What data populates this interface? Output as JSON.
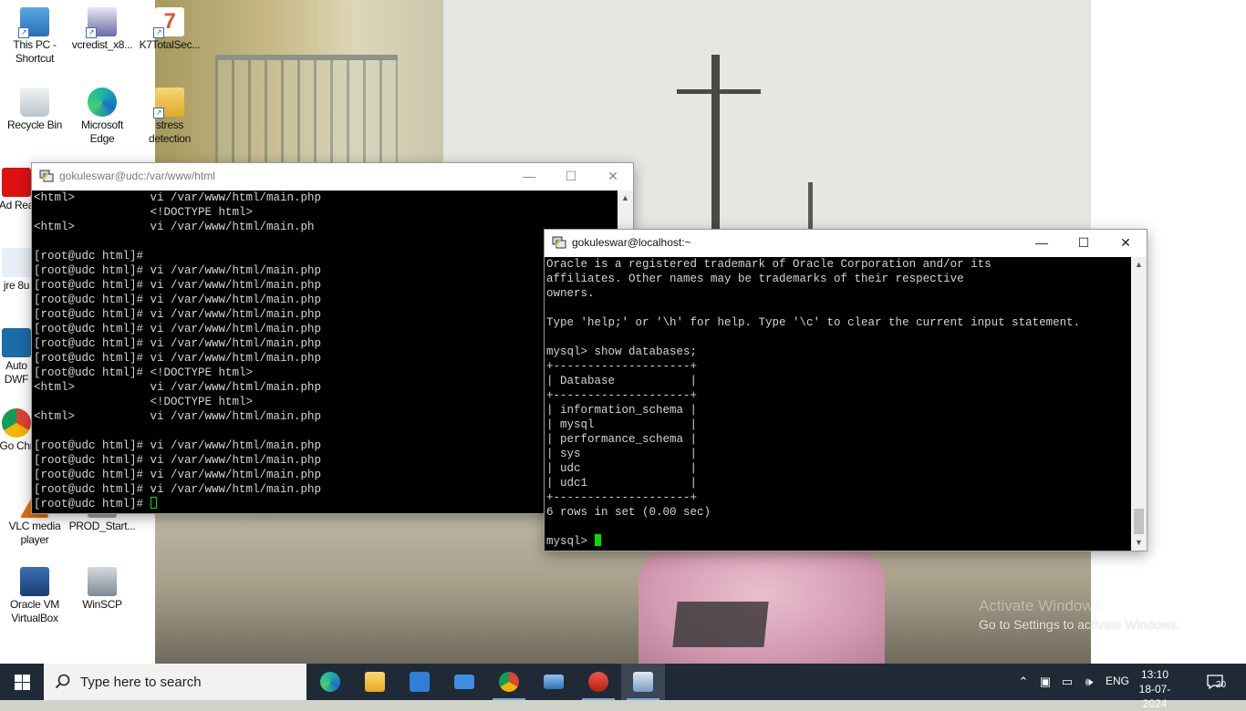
{
  "desktop": {
    "icons": [
      {
        "label": "This PC - Shortcut",
        "icon": "computer-icon"
      },
      {
        "label": "vcredist_x8...",
        "icon": "installer-icon"
      },
      {
        "label": "K7TotalSec...",
        "icon": "k7-antivirus-icon"
      },
      {
        "label": "Recycle Bin",
        "icon": "recycle-bin-icon"
      },
      {
        "label": "Microsoft Edge",
        "icon": "edge-icon"
      },
      {
        "label": "stress detection",
        "icon": "folder-icon"
      },
      {
        "label": "Ad Rea",
        "icon": "acrobat-icon"
      },
      {
        "label": "jre 8u",
        "icon": "java-icon"
      },
      {
        "label": "Auto DWF",
        "icon": "autodesk-icon"
      },
      {
        "label": "Go Chr",
        "icon": "chrome-icon"
      },
      {
        "label": "VLC media player",
        "icon": "vlc-icon"
      },
      {
        "label": "PROD_Start...",
        "icon": "file-icon"
      },
      {
        "label": "Oracle VM VirtualBox",
        "icon": "virtualbox-icon"
      },
      {
        "label": "WinSCP",
        "icon": "winscp-icon"
      }
    ],
    "watermark": {
      "title": "Activate Windows",
      "subtitle": "Go to Settings to activate Windows."
    }
  },
  "window_back": {
    "title": "gokuleswar@udc:/var/www/html",
    "lines": [
      "<html>           vi /var/www/html/main.php",
      "                 <!DOCTYPE html>",
      "<html>           vi /var/www/html/main.ph",
      "",
      "[root@udc html]#",
      "[root@udc html]# vi /var/www/html/main.php",
      "[root@udc html]# vi /var/www/html/main.php",
      "[root@udc html]# vi /var/www/html/main.php",
      "[root@udc html]# vi /var/www/html/main.php",
      "[root@udc html]# vi /var/www/html/main.php",
      "[root@udc html]# vi /var/www/html/main.php",
      "[root@udc html]# vi /var/www/html/main.php",
      "[root@udc html]# <!DOCTYPE html>",
      "<html>           vi /var/www/html/main.php",
      "                 <!DOCTYPE html>",
      "<html>           vi /var/www/html/main.php",
      "",
      "[root@udc html]# vi /var/www/html/main.php",
      "[root@udc html]# vi /var/www/html/main.php",
      "[root@udc html]# vi /var/www/html/main.php",
      "[root@udc html]# vi /var/www/html/main.php"
    ],
    "prompt": "[root@udc html]# "
  },
  "window_front": {
    "title": "gokuleswar@localhost:~",
    "lines": [
      "Oracle is a registered trademark of Oracle Corporation and/or its",
      "affiliates. Other names may be trademarks of their respective",
      "owners.",
      "",
      "Type 'help;' or '\\h' for help. Type '\\c' to clear the current input statement.",
      "",
      "mysql> show databases;",
      "+--------------------+",
      "| Database           |",
      "+--------------------+",
      "| information_schema |",
      "| mysql              |",
      "| performance_schema |",
      "| sys                |",
      "| udc                |",
      "| udc1               |",
      "+--------------------+",
      "6 rows in set (0.00 sec)",
      ""
    ],
    "prompt": "mysql> "
  },
  "window_controls": {
    "minimize": "—",
    "maximize": "☐",
    "close": "✕"
  },
  "taskbar": {
    "search_placeholder": "Type here to search",
    "apps": [
      "edge-icon",
      "file-explorer-icon",
      "store-icon",
      "mail-icon",
      "chrome-icon",
      "remote-desktop-icon",
      "oracle-sql-icon",
      "putty-icon"
    ],
    "language": "ENG",
    "time": "13:10",
    "date": "18-07-2024",
    "notifications": "20"
  },
  "colors": {
    "terminal_bg": "#000000",
    "terminal_fg": "#d4d4d4",
    "cursor": "#00e000",
    "taskbar": "#1f2a36"
  }
}
